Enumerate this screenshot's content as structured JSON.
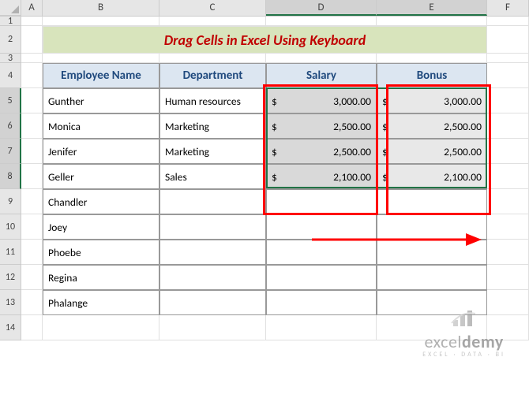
{
  "columns": [
    "A",
    "B",
    "C",
    "D",
    "E",
    "F"
  ],
  "rows": [
    1,
    2,
    3,
    4,
    5,
    6,
    7,
    8,
    9,
    10,
    11,
    12,
    13,
    14
  ],
  "title": "Drag Cells in Excel Using Keyboard",
  "headers": {
    "name": "Employee Name",
    "dept": "Department",
    "salary": "Salary",
    "bonus": "Bonus"
  },
  "data": [
    {
      "name": "Gunther",
      "dept": "Human resources",
      "salary": "3,000.00",
      "bonus": "3,000.00"
    },
    {
      "name": "Monica",
      "dept": "Marketing",
      "salary": "2,500.00",
      "bonus": "2,500.00"
    },
    {
      "name": "Jenifer",
      "dept": "Marketing",
      "salary": "2,500.00",
      "bonus": "2,500.00"
    },
    {
      "name": "Geller",
      "dept": "Sales",
      "salary": "2,100.00",
      "bonus": "2,100.00"
    },
    {
      "name": "Chandler",
      "dept": "",
      "salary": "",
      "bonus": ""
    },
    {
      "name": "Joey",
      "dept": "",
      "salary": "",
      "bonus": ""
    },
    {
      "name": "Phoebe",
      "dept": "",
      "salary": "",
      "bonus": ""
    },
    {
      "name": "Regina",
      "dept": "",
      "salary": "",
      "bonus": ""
    },
    {
      "name": "Phalange",
      "dept": "",
      "salary": "",
      "bonus": ""
    }
  ],
  "currency_sign": "$",
  "watermark": {
    "brand": "exceldemy",
    "tag": "EXCEL · DATA · BI"
  }
}
